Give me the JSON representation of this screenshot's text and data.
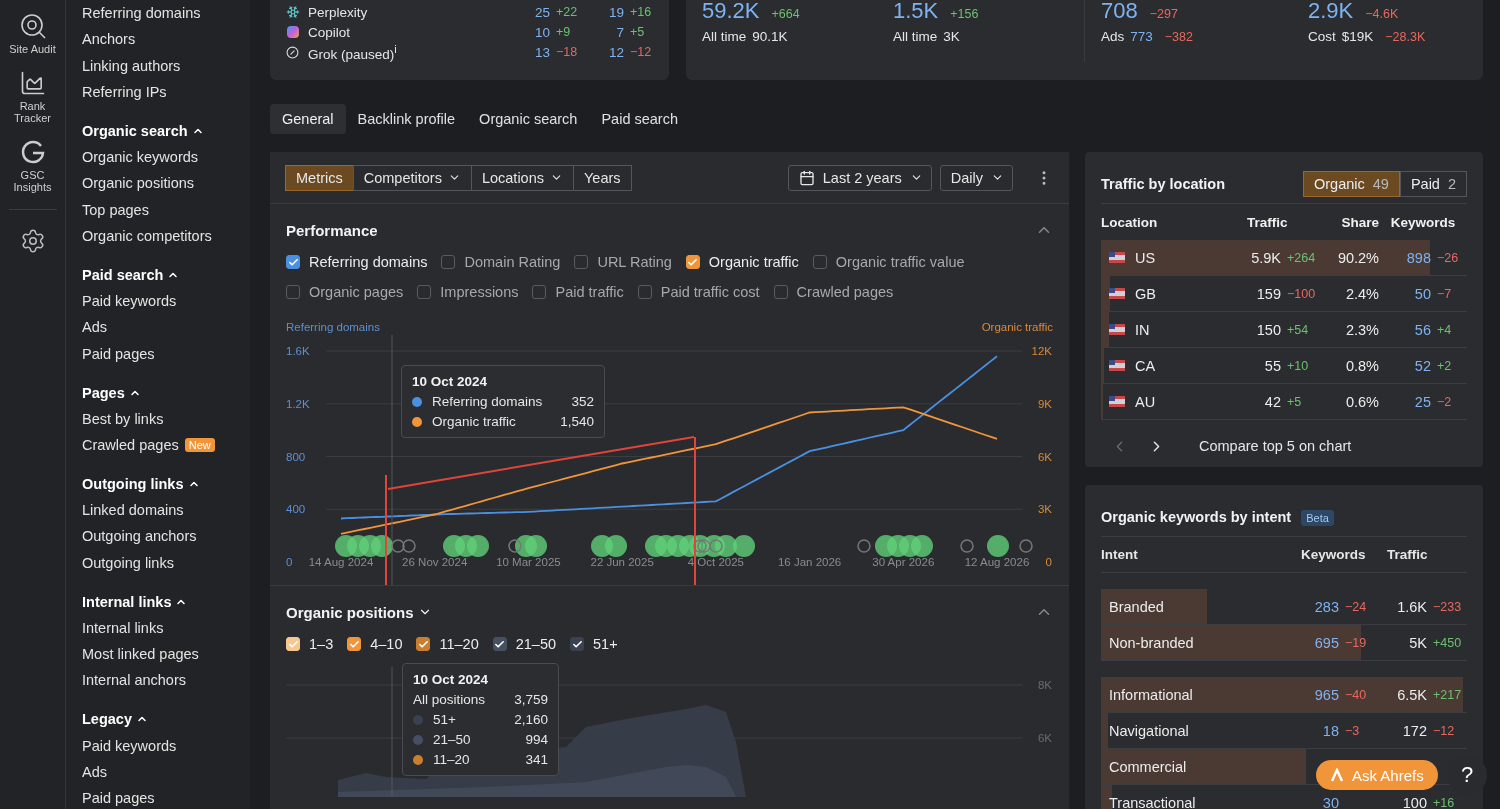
{
  "rail": {
    "items": [
      {
        "label": "Site Audit"
      },
      {
        "label": "Rank Tracker"
      },
      {
        "label": "GSC Insights"
      }
    ]
  },
  "sidebar": {
    "items": [
      {
        "label": "Referring domains"
      },
      {
        "label": "Anchors"
      },
      {
        "label": "Linking authors"
      },
      {
        "label": "Referring IPs"
      }
    ],
    "sections": [
      {
        "title": "Organic search",
        "expanded": true,
        "items": [
          {
            "label": "Organic keywords"
          },
          {
            "label": "Organic positions"
          },
          {
            "label": "Top pages"
          },
          {
            "label": "Organic competitors"
          }
        ]
      },
      {
        "title": "Paid search",
        "expanded": true,
        "items": [
          {
            "label": "Paid keywords"
          },
          {
            "label": "Ads"
          },
          {
            "label": "Paid pages"
          }
        ]
      },
      {
        "title": "Pages",
        "expanded": true,
        "items": [
          {
            "label": "Best by links"
          },
          {
            "label": "Crawled pages",
            "badge": "New"
          }
        ]
      },
      {
        "title": "Outgoing links",
        "expanded": true,
        "items": [
          {
            "label": "Linked domains"
          },
          {
            "label": "Outgoing anchors"
          },
          {
            "label": "Outgoing links"
          }
        ]
      },
      {
        "title": "Internal links",
        "expanded": true,
        "items": [
          {
            "label": "Internal links"
          },
          {
            "label": "Most linked pages"
          },
          {
            "label": "Internal anchors"
          }
        ]
      },
      {
        "title": "Legacy",
        "expanded": true,
        "items": [
          {
            "label": "Paid keywords"
          },
          {
            "label": "Ads"
          },
          {
            "label": "Paid pages"
          }
        ]
      }
    ]
  },
  "ai_mentions": {
    "rows": [
      {
        "name": "Perplexity",
        "values": [
          {
            "text": "25",
            "delta": "+22",
            "positive": true
          },
          {
            "text": "19",
            "delta": "+16",
            "positive": true
          }
        ]
      },
      {
        "name": "Copilot",
        "values": [
          {
            "text": "10",
            "delta": "+9",
            "positive": true
          },
          {
            "text": "7",
            "delta": "+5",
            "positive": true
          }
        ]
      },
      {
        "name": "Grok (paused)$^{i}$",
        "values": [
          {
            "text": "13",
            "delta": "−18",
            "positive": false
          },
          {
            "text": "12",
            "delta": "−12",
            "positive": false
          }
        ]
      }
    ]
  },
  "stats": [
    {
      "value": "59.2K",
      "delta": "+664",
      "positive": true,
      "sub_label": "All time",
      "sub_value": "90.1K",
      "sub_link": false
    },
    {
      "value": "1.5K",
      "delta": "+156",
      "positive": true,
      "sub_label": "All time",
      "sub_value": "3K",
      "sub_link": false
    },
    {
      "value": "708",
      "delta": "−297",
      "positive": false,
      "sub_label": "Ads",
      "sub_value": "773",
      "sub_link": true,
      "sub_delta": "−382",
      "sub_positive": false
    },
    {
      "value": "2.9K",
      "delta": "−4.6K",
      "positive": false,
      "sub_label": "Cost",
      "sub_value": "$19K",
      "sub_link": false,
      "sub_delta": "−28.3K",
      "sub_positive": false
    }
  ],
  "tabs": [
    {
      "label": "General",
      "selected": true
    },
    {
      "label": "Backlink profile",
      "selected": false
    },
    {
      "label": "Organic search",
      "selected": false
    },
    {
      "label": "Paid search",
      "selected": false
    }
  ],
  "toolbar": {
    "segments": [
      {
        "label": "Metrics",
        "selected": true,
        "dropdown": false
      },
      {
        "label": "Competitors",
        "selected": false,
        "dropdown": true
      },
      {
        "label": "Locations",
        "selected": false,
        "dropdown": true
      },
      {
        "label": "Years",
        "selected": false,
        "dropdown": false
      }
    ],
    "period": "Last 2 years",
    "interval": "Daily"
  },
  "performance": {
    "title": "Performance",
    "expanded": true,
    "metrics": [
      {
        "label": "Referring domains",
        "checked": true,
        "color": "#4a90e2"
      },
      {
        "label": "Domain Rating",
        "checked": false
      },
      {
        "label": "URL Rating",
        "checked": false
      },
      {
        "label": "Organic traffic",
        "checked": true,
        "color": "#f0953a"
      },
      {
        "label": "Organic traffic value",
        "checked": false
      },
      {
        "label": "Organic pages",
        "checked": false
      },
      {
        "label": "Impressions",
        "checked": false
      },
      {
        "label": "Paid traffic",
        "checked": false
      },
      {
        "label": "Paid traffic cost",
        "checked": false
      },
      {
        "label": "Crawled pages",
        "checked": false
      }
    ],
    "tooltip": {
      "date": "10 Oct 2024",
      "rows": [
        {
          "label": "Referring domains",
          "value": "352",
          "color": "#4a90e2"
        },
        {
          "label": "Organic traffic",
          "value": "1,540",
          "color": "#f0953a"
        }
      ]
    },
    "referring_chart": {
      "chart_data": {
        "type": "line",
        "categories": [
          "14 Aug 2024",
          "26 Nov 2024",
          "10 Mar 2025",
          "22 Jun 2025",
          "4 Oct 2025",
          "16 Jan 2026",
          "30 Apr 2026",
          "12 Aug 2026"
        ],
        "series": [
          {
            "name": "Referring domains",
            "color": "#4a90e2",
            "values": [
              330,
              360,
              380,
              420,
              460,
              840,
              1000,
              1560
            ]
          }
        ],
        "ylim": [
          0,
          1600
        ],
        "grid": true,
        "yticks": [
          {
            "value": 0,
            "label": "0"
          },
          {
            "value": 400,
            "label": "400"
          },
          {
            "value": 800,
            "label": "800"
          },
          {
            "value": 1200,
            "label": "1.2K"
          },
          {
            "value": 1600,
            "label": "1.6K"
          }
        ]
      }
    },
    "traffic_chart": {
      "chart_data": {
        "type": "line",
        "series": [
          {
            "name": "Organic traffic",
            "color": "#f0953a",
            "values": [
              1600,
              2700,
              4200,
              5600,
              6700,
              8500,
              8800,
              7000
            ]
          }
        ],
        "ylim": [
          0,
          12000
        ],
        "yticks": [
          {
            "value": 0,
            "label": "0"
          },
          {
            "value": 3000,
            "label": "3K"
          },
          {
            "value": 6000,
            "label": "6K"
          },
          {
            "value": 9000,
            "label": "9K"
          },
          {
            "value": 12000,
            "label": "12K"
          }
        ]
      }
    }
  },
  "positions": {
    "title": "Organic positions",
    "expanded": true,
    "ranges": [
      {
        "label": "1–3",
        "checked": true,
        "color": "#f6c88f"
      },
      {
        "label": "4–10",
        "checked": true,
        "color": "#f0953a"
      },
      {
        "label": "11–20",
        "checked": true,
        "color": "#c97f30"
      },
      {
        "label": "21–50",
        "checked": true,
        "color": "#465063"
      },
      {
        "label": "51+",
        "checked": true,
        "color": "#3a4252"
      }
    ],
    "axis_labels": [
      "8K",
      "6K"
    ],
    "tooltip": {
      "date": "10 Oct 2024",
      "total_label": "All positions",
      "total_value": "3,759",
      "rows": [
        {
          "label": "51+",
          "value": "2,160",
          "color": "#3a4252"
        },
        {
          "label": "21–50",
          "value": "994",
          "color": "#465063"
        },
        {
          "label": "11–20",
          "value": "341",
          "color": "#c97f30"
        }
      ]
    }
  },
  "traffic_by_location": {
    "title": "Traffic by location",
    "toggle": [
      {
        "label": "Organic",
        "count": "49",
        "selected": true
      },
      {
        "label": "Paid",
        "count": "2",
        "selected": false
      }
    ],
    "columns": [
      "Location",
      "Traffic",
      "Share",
      "Keywords"
    ],
    "rows": [
      {
        "code": "US",
        "traffic": "5.9K",
        "traffic_delta": "+264",
        "traffic_positive": true,
        "share": "90.2%",
        "level": 0.9,
        "keywords": "898",
        "keywords_delta": "−26",
        "keywords_positive": false
      },
      {
        "code": "GB",
        "traffic": "159",
        "traffic_delta": "−100",
        "traffic_positive": false,
        "share": "2.4%",
        "level": 0.024,
        "keywords": "50",
        "keywords_delta": "−7",
        "keywords_positive": false
      },
      {
        "code": "IN",
        "traffic": "150",
        "traffic_delta": "+54",
        "traffic_positive": true,
        "share": "2.3%",
        "level": 0.023,
        "keywords": "56",
        "keywords_delta": "+4",
        "keywords_positive": true
      },
      {
        "code": "CA",
        "traffic": "55",
        "traffic_delta": "+10",
        "traffic_positive": true,
        "share": "0.8%",
        "level": 0.008,
        "keywords": "52",
        "keywords_delta": "+2",
        "keywords_positive": true
      },
      {
        "code": "AU",
        "traffic": "42",
        "traffic_delta": "+5",
        "traffic_positive": true,
        "share": "0.6%",
        "level": 0.006,
        "keywords": "25",
        "keywords_delta": "−2",
        "keywords_positive": false
      }
    ],
    "prev_disabled": true,
    "compare_label": "Compare top 5 on chart"
  },
  "intent": {
    "title": "Organic keywords by intent",
    "badge": "Beta",
    "columns": [
      "Intent",
      "Keywords",
      "Traffic"
    ],
    "groups": [
      {
        "rows": [
          {
            "label": "Branded",
            "level": 0.29,
            "keywords": "283",
            "keywords_delta": "−24",
            "keywords_positive": false,
            "traffic": "1.6K",
            "traffic_delta": "−233",
            "traffic_positive": false
          },
          {
            "label": "Non-branded",
            "level": 0.71,
            "keywords": "695",
            "keywords_delta": "−19",
            "keywords_positive": false,
            "traffic": "5K",
            "traffic_delta": "+450",
            "traffic_positive": true
          }
        ]
      },
      {
        "rows": [
          {
            "label": "Informational",
            "level": 0.99,
            "keywords": "965",
            "keywords_delta": "−40",
            "keywords_positive": false,
            "traffic": "6.5K",
            "traffic_delta": "+217",
            "traffic_positive": true
          },
          {
            "label": "Navigational",
            "level": 0.02,
            "keywords": "18",
            "keywords_delta": "−3",
            "keywords_positive": false,
            "traffic": "172",
            "traffic_delta": "−12",
            "traffic_positive": false
          },
          {
            "label": "Commercial",
            "level": 0.56
          },
          {
            "label": "Transactional",
            "level": 0.03,
            "keywords": "30",
            "traffic": "100",
            "traffic_delta": "+16",
            "traffic_positive": true
          }
        ]
      }
    ]
  },
  "assistant_button": {
    "label": "Ask Ahrefs"
  },
  "help_button": {
    "label": "?"
  }
}
